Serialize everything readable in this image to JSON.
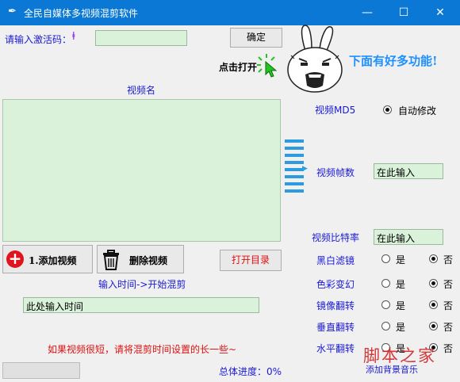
{
  "window": {
    "title": "全民自媒体多视频混剪软件",
    "minimize": "—",
    "maximize": "☐",
    "close": "✕"
  },
  "activation": {
    "label": "请输入激活码：",
    "value": "",
    "confirm_label": "确定"
  },
  "promo": {
    "click_open": "点击打开",
    "more_features": "下面有好多功能!"
  },
  "video_list": {
    "header": "视频名",
    "items": []
  },
  "buttons": {
    "add_video": "1.添加视频",
    "delete_video": "删除视频",
    "open_dir": "打开目录"
  },
  "time": {
    "label": "输入时间->开始混剪",
    "placeholder": "此处输入时间",
    "hint": "如果视频很短，请将混剪时间设置的长一些~"
  },
  "settings": {
    "md5_label": "视频MD5",
    "md5_option": "自动修改",
    "fps_label": "视频帧数",
    "fps_value": "在此输入",
    "bitrate_label": "视频比特率",
    "bitrate_value": "在此输入",
    "yes": "是",
    "no": "否",
    "toggles": [
      {
        "label": "黑白滤镜",
        "selected": "否"
      },
      {
        "label": "色彩变幻",
        "selected": "否"
      },
      {
        "label": "镜像翻转",
        "selected": "否"
      },
      {
        "label": "垂直翻转",
        "selected": "否"
      },
      {
        "label": "水平翻转",
        "selected": "否"
      }
    ]
  },
  "progress": {
    "label": "总体进度：0%",
    "value": 0
  },
  "watermark": {
    "text": "脚本之家",
    "sub": "添加背景音乐"
  },
  "colors": {
    "titlebar": "#0a78d4",
    "field": "#d9f2d9",
    "blue_text": "#1a1ad6",
    "red_text": "#e01010",
    "promo_blue": "#1e90ff"
  }
}
